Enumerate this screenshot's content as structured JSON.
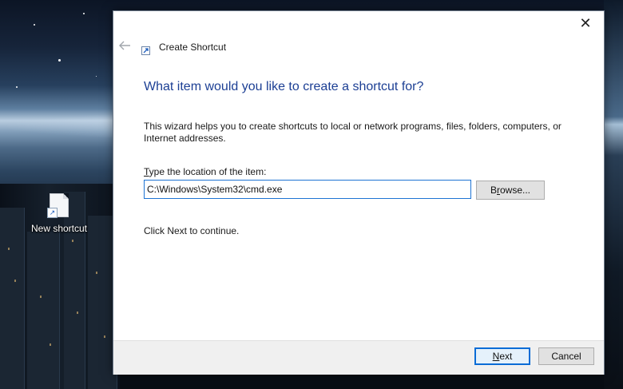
{
  "desktop": {
    "shortcut_label": "New shortcut",
    "shortcut_icon": "shortcut-file-icon"
  },
  "dialog": {
    "title": "Create Shortcut",
    "title_icon": "shortcut-icon",
    "back_icon": "back-arrow-icon",
    "close_glyph": "✕",
    "heading": "What item would you like to create a shortcut for?",
    "description": "This wizard helps you to create shortcuts to local or network programs, files, folders, computers, or Internet addresses.",
    "location_label_accel": "T",
    "location_label_rest": "ype the location of the item:",
    "location_value": "C:\\Windows\\System32\\cmd.exe",
    "browse_accel": "r",
    "browse_pre": "B",
    "browse_post": "owse...",
    "hint": "Click Next to continue.",
    "next_accel": "N",
    "next_rest": "ext",
    "cancel_label": "Cancel"
  },
  "colors": {
    "heading": "#1c3f94",
    "accent": "#0a6cd6",
    "footer_bg": "#f0f0f0"
  }
}
